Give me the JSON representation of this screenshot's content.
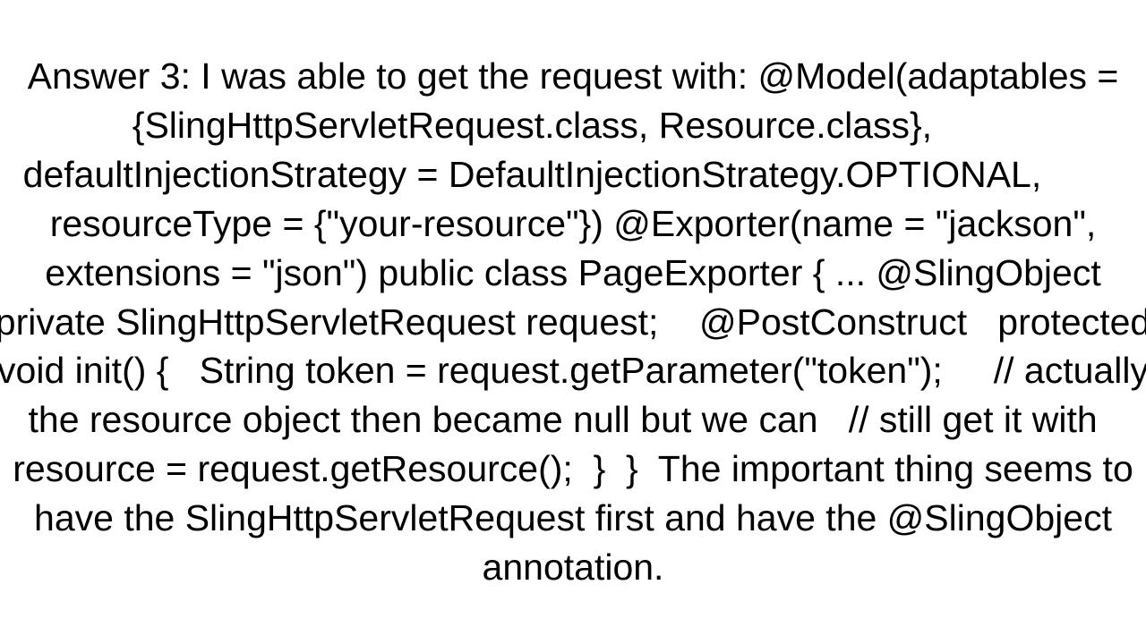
{
  "answer": {
    "label": "Answer 3:",
    "intro": "I was able to get the request with:",
    "code": "@Model(adaptables = {SlingHttpServletRequest.class, Resource.class},         defaultInjectionStrategy = DefaultInjectionStrategy.OPTIONAL,         resourceType = {\"your-resource\"}) @Exporter(name = \"jackson\", extensions = \"json\") public class PageExporter { ... @SlingObject private SlingHttpServletRequest request;    @PostConstruct   protected void init() {   String token = request.getParameter(\"token\");     // actually the resource object then became null but we can   // still get it with   resource = request.getResource();  }  }",
    "outro": "The important thing seems to have the SlingHttpServletRequest first and have the @SlingObject annotation."
  },
  "full_text": "Answer 3: I was able to get the request with: @Model(adaptables = {SlingHttpServletRequest.class, Resource.class},         defaultInjectionStrategy = DefaultInjectionStrategy.OPTIONAL,         resourceType = {\"your-resource\"}) @Exporter(name = \"jackson\", extensions = \"json\") public class PageExporter { ... @SlingObject private SlingHttpServletRequest request;    @PostConstruct   protected void init() {   String token = request.getParameter(\"token\");     // actually the resource object then became null but we can   // still get it with   resource = request.getResource();  }  }  The important thing seems to have the SlingHttpServletRequest first and have the @SlingObject annotation."
}
